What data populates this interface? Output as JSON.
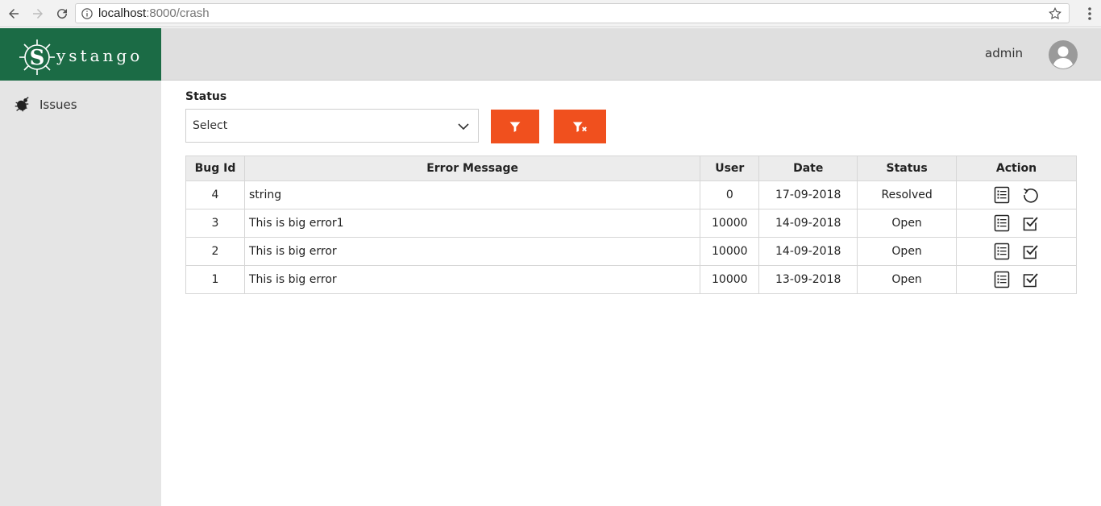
{
  "browser": {
    "url_host": "localhost",
    "url_path": ":8000/crash",
    "icons": [
      "back-icon",
      "forward-icon",
      "reload-icon",
      "info-icon",
      "star-icon",
      "menu-icon"
    ]
  },
  "brand": {
    "logo_letter": "S",
    "logo_text": "ystango",
    "color": "#1b6b45"
  },
  "header": {
    "user_name": "admin"
  },
  "sidebar": {
    "items": [
      {
        "label": "Issues",
        "icon": "bug-icon"
      }
    ]
  },
  "filter": {
    "label": "Status",
    "select_value": "Select",
    "accent": "#f0501e",
    "filter_icon": "filter-icon",
    "clear_icon": "filter-clear-icon"
  },
  "table": {
    "columns": [
      "Bug Id",
      "Error Message",
      "User",
      "Date",
      "Status",
      "Action"
    ],
    "rows": [
      {
        "id": "4",
        "message": "string",
        "user": "0",
        "date": "17-09-2018",
        "status": "Resolved",
        "actions": [
          "details-icon",
          "reopen-icon"
        ]
      },
      {
        "id": "3",
        "message": "This is big error1",
        "user": "10000",
        "date": "14-09-2018",
        "status": "Open",
        "actions": [
          "details-icon",
          "resolve-icon"
        ]
      },
      {
        "id": "2",
        "message": "This is big error",
        "user": "10000",
        "date": "14-09-2018",
        "status": "Open",
        "actions": [
          "details-icon",
          "resolve-icon"
        ]
      },
      {
        "id": "1",
        "message": "This is big error",
        "user": "10000",
        "date": "13-09-2018",
        "status": "Open",
        "actions": [
          "details-icon",
          "resolve-icon"
        ]
      }
    ]
  }
}
